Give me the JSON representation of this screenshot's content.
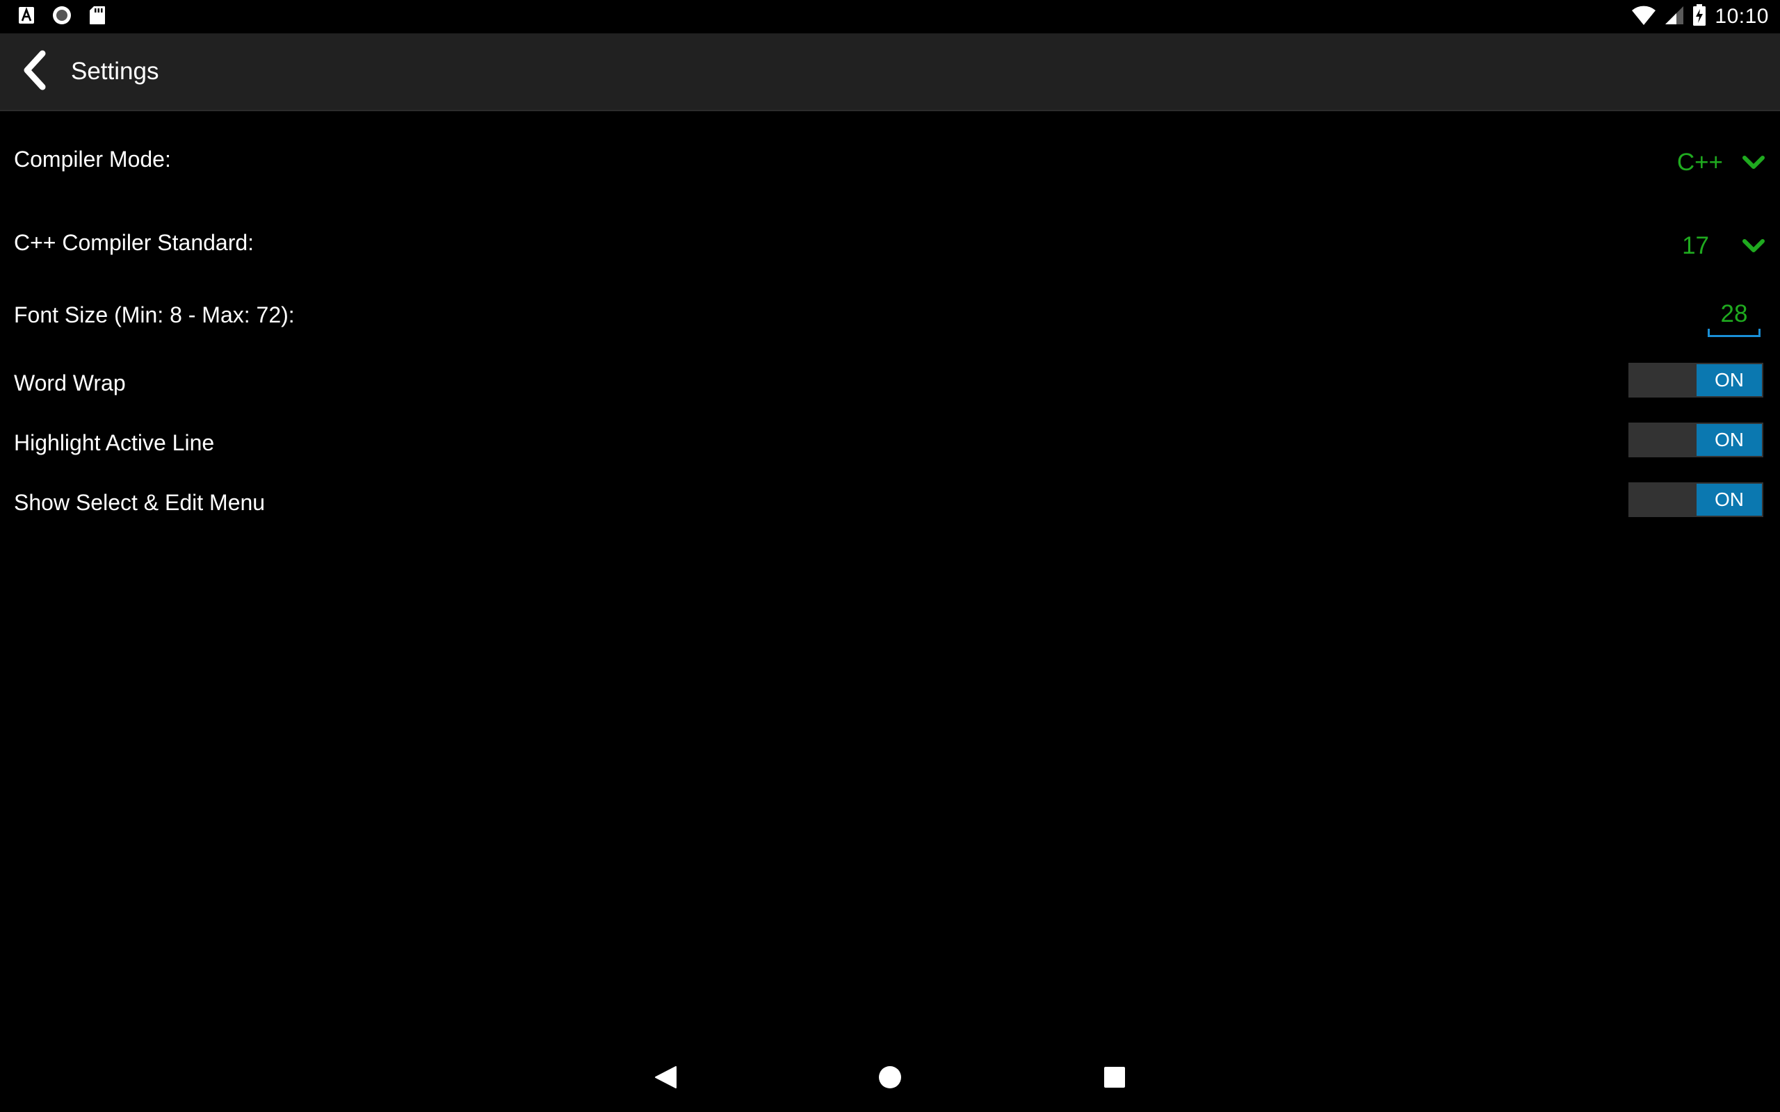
{
  "status_bar": {
    "time": "10:10",
    "left_icons": [
      "accessibility-icon",
      "record-icon",
      "sd-card-icon"
    ],
    "right_icons": [
      "wifi-icon",
      "cellular-signal-icon",
      "battery-charging-icon"
    ]
  },
  "app_bar": {
    "title": "Settings",
    "back_icon": "chevron-left-icon"
  },
  "settings": {
    "compiler_mode": {
      "label": "Compiler Mode:",
      "value": "C++"
    },
    "compiler_standard": {
      "label": "C++ Compiler Standard:",
      "value": "17"
    },
    "font_size": {
      "label": "Font Size (Min: 8 - Max: 72):",
      "value": "28"
    },
    "word_wrap": {
      "label": "Word Wrap",
      "state": "ON"
    },
    "highlight_active_line": {
      "label": "Highlight Active Line",
      "state": "ON"
    },
    "show_select_edit_menu": {
      "label": "Show Select & Edit Menu",
      "state": "ON"
    }
  },
  "nav_bar": {
    "buttons": [
      "back-triangle-icon",
      "home-circle-icon",
      "recents-square-icon"
    ]
  },
  "colors": {
    "background": "#000000",
    "app_bar": "#212121",
    "accent_green": "#1faa1f",
    "toggle_on": "#0b78b0",
    "toggle_track": "#333333",
    "input_underline": "#1a8fd6"
  }
}
